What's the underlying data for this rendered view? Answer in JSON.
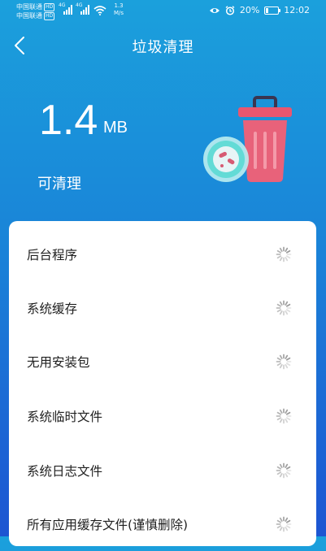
{
  "status_bar": {
    "carrier1": "中国联通",
    "carrier2": "中国联通",
    "hd_tag": "HD",
    "net_tag1": "4G",
    "net_tag2": "4G",
    "speed_value": "1.3",
    "speed_unit": "M/s",
    "battery_percent": "20%",
    "battery_level": 0.2,
    "time": "12:02"
  },
  "header": {
    "title": "垃圾清理",
    "back_icon": "chevron-left-icon"
  },
  "summary": {
    "size_value": "1.4",
    "size_unit": "MB",
    "label": "可清理"
  },
  "items": [
    {
      "label": "后台程序"
    },
    {
      "label": "系统缓存"
    },
    {
      "label": "无用安装包"
    },
    {
      "label": "系统临时文件"
    },
    {
      "label": "系统日志文件"
    },
    {
      "label": "所有应用缓存文件(谨慎删除)"
    }
  ],
  "colors": {
    "bg_top": "#1ba0dc",
    "bg_bottom": "#1d55d2",
    "trash_body": "#e8627a",
    "trash_lid": "#e9566f",
    "bubble_fill": "#63dbd6",
    "spinner": "#9a9a9a"
  }
}
